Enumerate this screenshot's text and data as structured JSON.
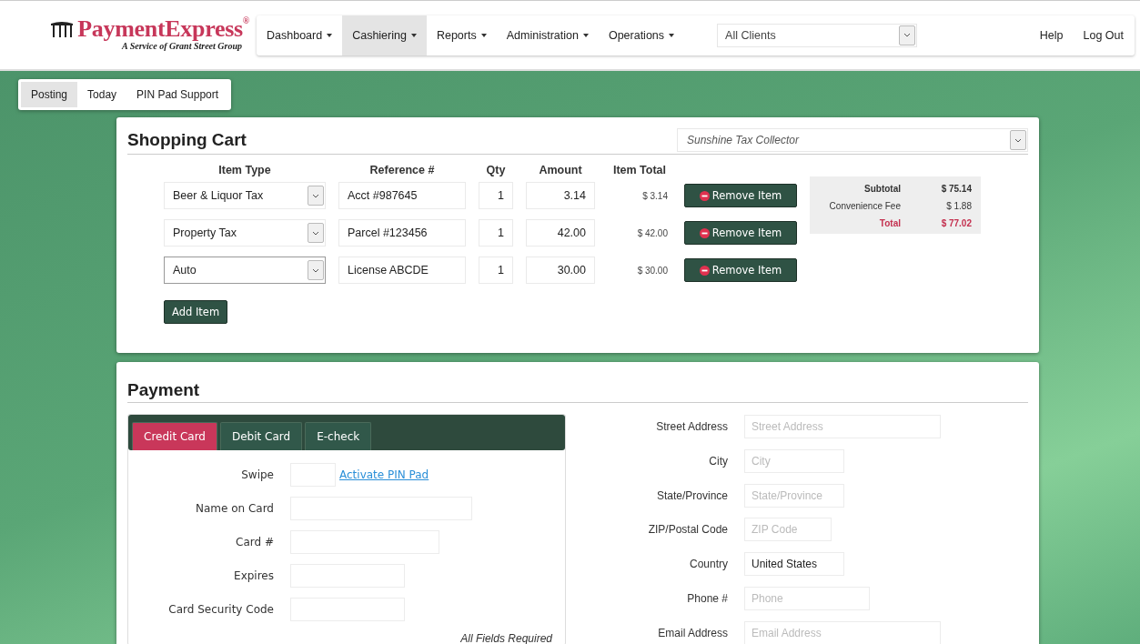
{
  "header": {
    "logo": {
      "name": "PaymentExpress$^{®}$",
      "tagline": "A Service of Grant Street Group"
    },
    "nav": [
      {
        "label": "Dashboard",
        "selected": false
      },
      {
        "label": "Cashiering",
        "selected": true
      },
      {
        "label": "Reports",
        "selected": false
      },
      {
        "label": "Administration",
        "selected": false
      },
      {
        "label": "Operations",
        "selected": false
      }
    ],
    "client_select": {
      "value": "All Clients"
    },
    "links": [
      "Help",
      "Log Out"
    ]
  },
  "subnav": [
    {
      "label": "Posting",
      "selected": true
    },
    {
      "label": "Today",
      "selected": false
    },
    {
      "label": "PIN Pad Support",
      "selected": false
    }
  ],
  "cart": {
    "title": "Shopping Cart",
    "collector_select": {
      "value": "Sunshine Tax Collector"
    },
    "columns": [
      "Item Type",
      "Reference #",
      "Qty",
      "Amount",
      "Item Total"
    ],
    "rows": [
      {
        "item_type": "Beer & Liquor Tax",
        "reference": "Acct #987645",
        "qty": "1",
        "amount": "3.14",
        "item_total": "$ 3.14",
        "remove": "Remove Item",
        "focused": false
      },
      {
        "item_type": "Property Tax",
        "reference": "Parcel #123456",
        "qty": "1",
        "amount": "42.00",
        "item_total": "$ 42.00",
        "remove": "Remove Item",
        "focused": false
      },
      {
        "item_type": "Auto",
        "reference": "License ABCDE",
        "qty": "1",
        "amount": "30.00",
        "item_total": "$ 30.00",
        "remove": "Remove Item",
        "focused": true
      }
    ],
    "add_button": "Add Item",
    "summary": [
      {
        "label": "Subtotal",
        "value": "$ 75.14",
        "kind": "bold"
      },
      {
        "label": "Convenience Fee",
        "value": "$ 1.88",
        "kind": "plain"
      },
      {
        "label": "Total",
        "value": "$ 77.02",
        "kind": "total"
      }
    ]
  },
  "payment": {
    "title": "Payment",
    "tabs": [
      {
        "label": "Credit Card",
        "selected": true
      },
      {
        "label": "Debit Card",
        "selected": false
      },
      {
        "label": "E-check",
        "selected": false
      }
    ],
    "card_fields": [
      {
        "label": "Swipe",
        "link": "Activate PIN Pad"
      },
      {
        "label": "Name on Card"
      },
      {
        "label": "Card #"
      },
      {
        "label": "Expires"
      },
      {
        "label": "Card Security Code"
      }
    ],
    "note": "All Fields Required",
    "address_fields": [
      {
        "label": "Street Address",
        "placeholder": "Street Address"
      },
      {
        "label": "City",
        "placeholder": "City"
      },
      {
        "label": "State/Province",
        "placeholder": "State/Province"
      },
      {
        "label": "ZIP/Postal Code",
        "placeholder": "ZIP Code"
      },
      {
        "label": "Country",
        "value": "United States"
      },
      {
        "label": "Phone #",
        "placeholder": "Phone"
      },
      {
        "label": "Email Address",
        "placeholder": "Email Address"
      }
    ]
  }
}
